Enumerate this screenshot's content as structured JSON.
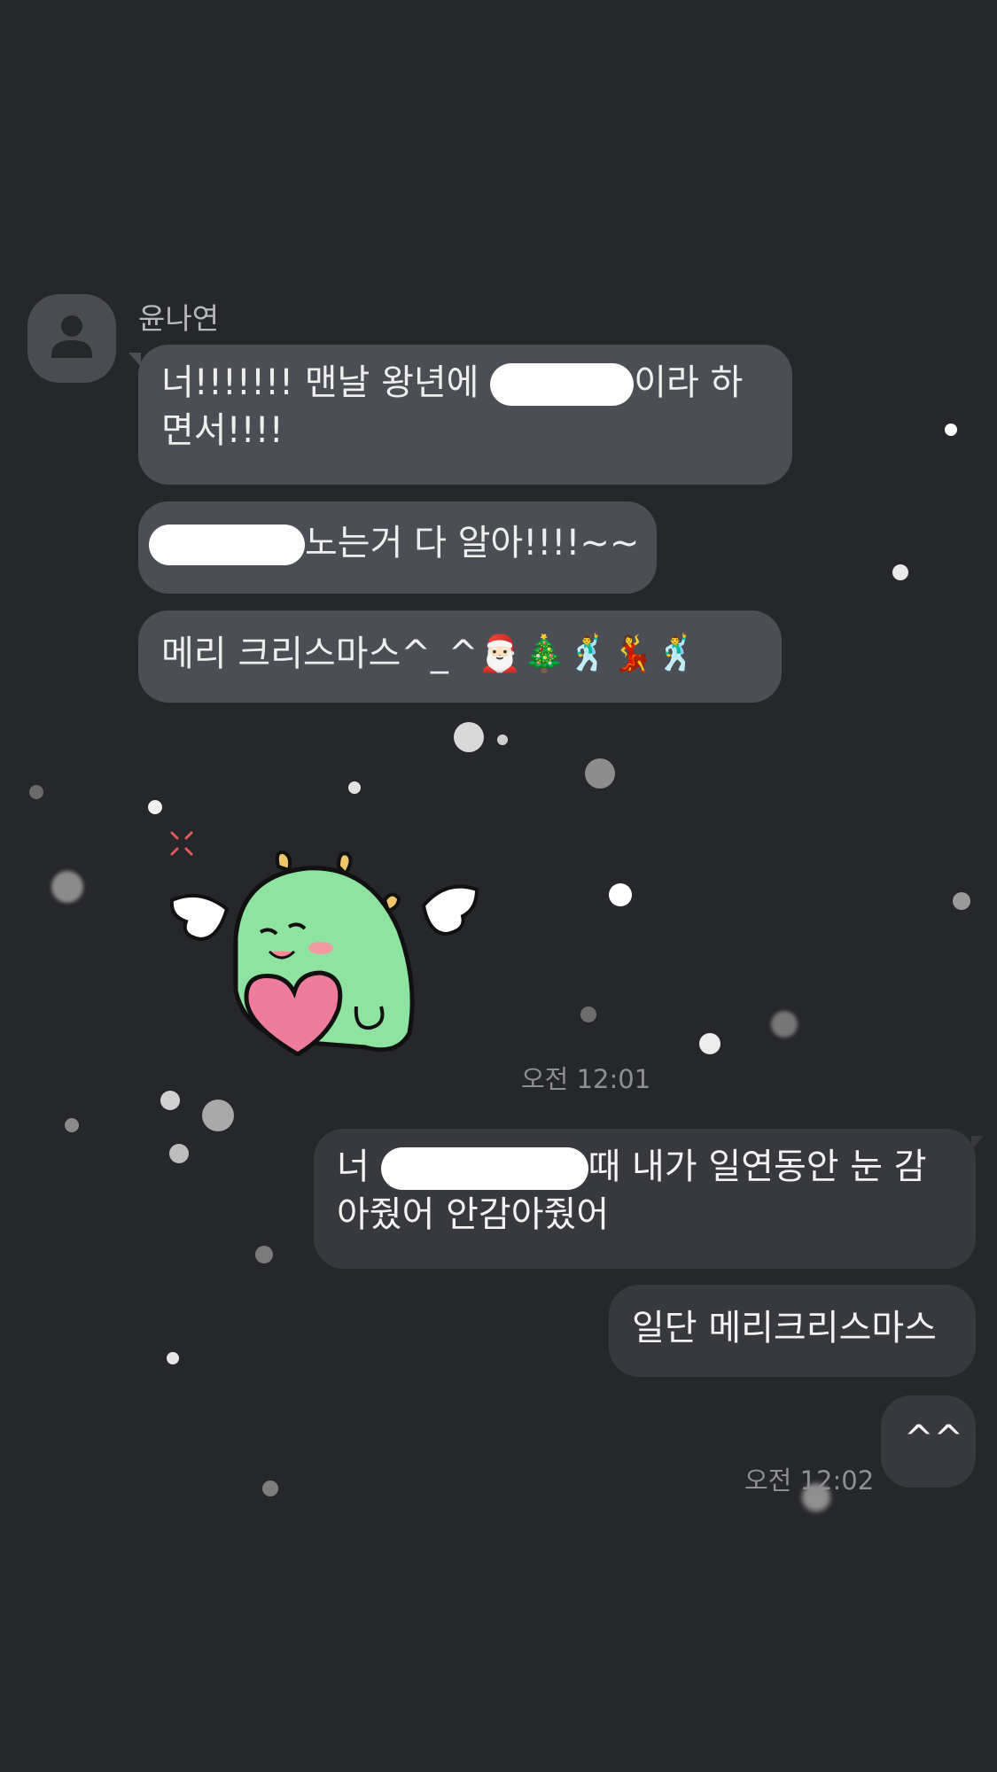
{
  "chat": {
    "sender_name": "윤나연",
    "received": [
      {
        "before": "너!!!!!!! 맨날 왕년에 ",
        "after": "이라 하면서!!!!"
      },
      {
        "after": "노는거 다 알아!!!!~~"
      },
      {
        "text": "메리 크리스마스^_^🎅🏻🎄🕺💃🕺"
      }
    ],
    "time_received": "오전 12:01",
    "sent": [
      {
        "before": "너 ",
        "after": "때 내가 일연동안 눈 감아줬어 안감아줬어"
      },
      {
        "text": "일단 메리크리스마스"
      },
      {
        "text": "^^"
      }
    ],
    "time_sent": "오전 12:02",
    "sticker_icon": "winged-green-dino-with-heart-sticker",
    "avatar_icon": "person-silhouette-icon"
  },
  "colors": {
    "background": "#26272b",
    "received_bubble": "#4c4e55",
    "sent_bubble": "#38393f"
  }
}
